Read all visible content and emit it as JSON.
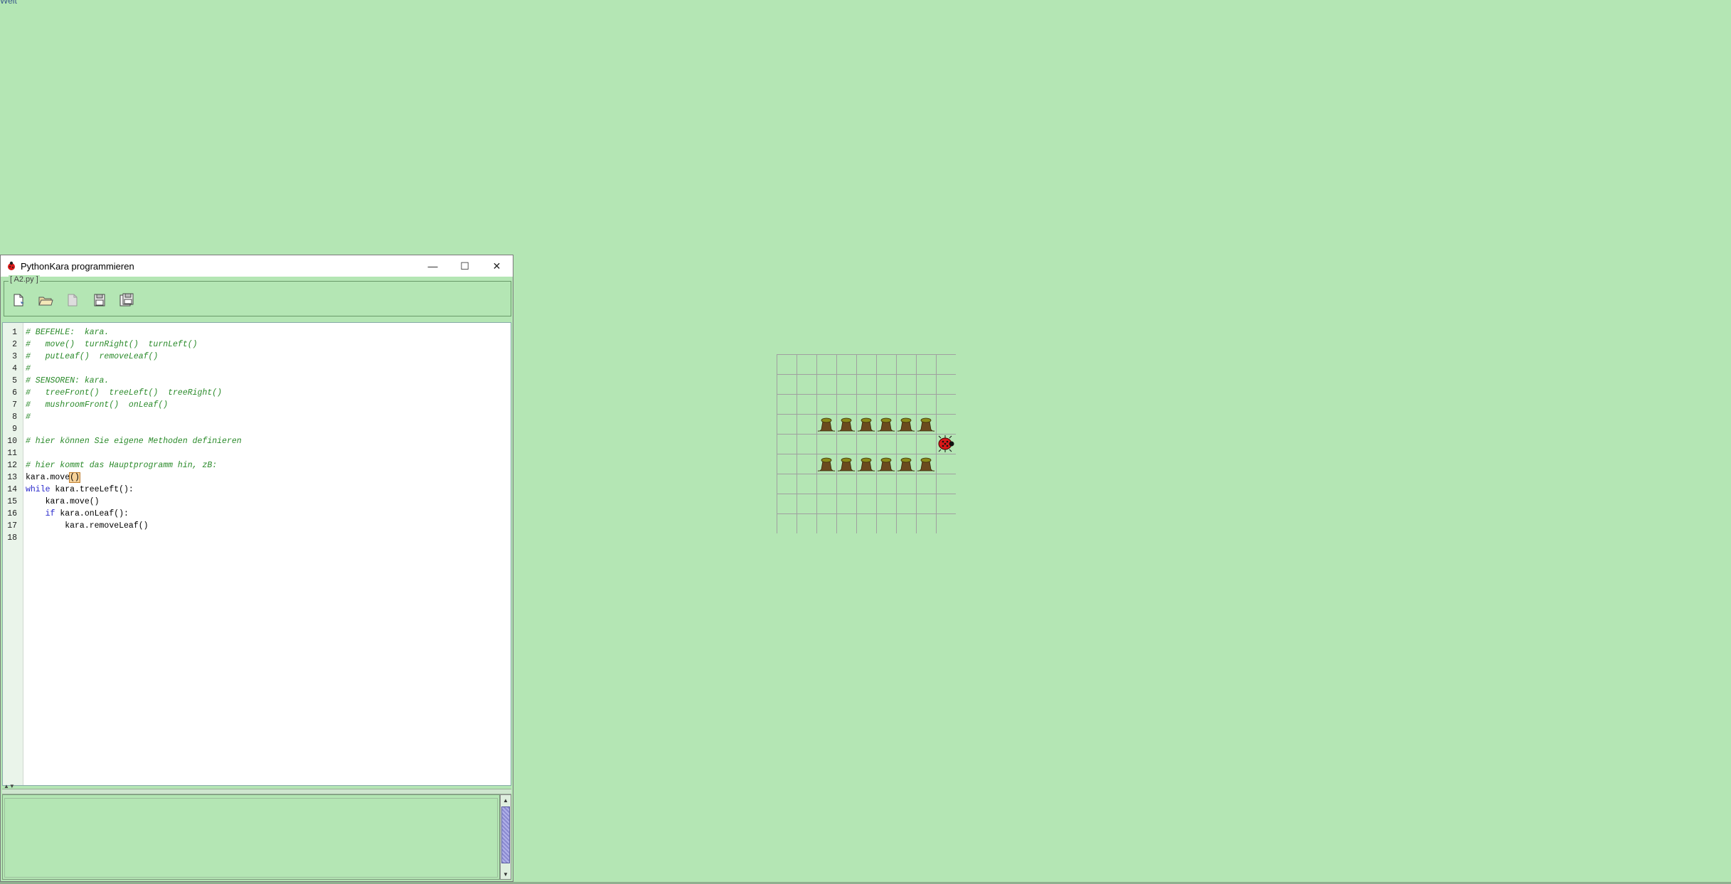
{
  "desktop": {
    "corner_text": "Welt"
  },
  "window": {
    "title": "PythonKara programmieren",
    "minimize": "—",
    "maximize": "☐",
    "close": "✕",
    "file_label": "[ A2.py ]",
    "toolbar": {
      "new": "new-file-icon",
      "open": "open-folder-icon",
      "blank": "document-icon",
      "save": "save-icon",
      "save_as": "save-as-icon"
    }
  },
  "code_lines": [
    {
      "n": "1",
      "text": "# BEFEHLE:  kara."
    },
    {
      "n": "2",
      "text": "#   move()  turnRight()  turnLeft()"
    },
    {
      "n": "3",
      "text": "#   putLeaf()  removeLeaf()"
    },
    {
      "n": "4",
      "text": "#"
    },
    {
      "n": "5",
      "text": "# SENSOREN: kara."
    },
    {
      "n": "6",
      "text": "#   treeFront()  treeLeft()  treeRight()"
    },
    {
      "n": "7",
      "text": "#   mushroomFront()  onLeaf()"
    },
    {
      "n": "8",
      "text": "#"
    },
    {
      "n": "9",
      "text": ""
    },
    {
      "n": "10",
      "text": "# hier können Sie eigene Methoden definieren"
    },
    {
      "n": "11",
      "text": ""
    },
    {
      "n": "12",
      "text": "# hier kommt das Hauptprogramm hin, zB:"
    },
    {
      "n": "13",
      "text": "kara.move()"
    },
    {
      "n": "14",
      "kw": "while",
      "text": " kara.treeLeft():"
    },
    {
      "n": "15",
      "text": "    kara.move()"
    },
    {
      "n": "16",
      "kw": "    if",
      "text": " kara.onLeaf():"
    },
    {
      "n": "17",
      "text": "        kara.removeLeaf()"
    },
    {
      "n": "18",
      "text": ""
    }
  ],
  "colors": {
    "background": "#b4e6b4",
    "comment": "#2a8a2a",
    "keyword": "#2a2acc",
    "grid_line": "#a0a0a0",
    "tree_trunk": "#6b4a1e",
    "tree_leaf": "#8a8a1a",
    "kara_red": "#d81818"
  },
  "world": {
    "cols": 9,
    "rows": 9,
    "trees": [
      [
        2,
        3
      ],
      [
        3,
        3
      ],
      [
        4,
        3
      ],
      [
        5,
        3
      ],
      [
        6,
        3
      ],
      [
        7,
        3
      ],
      [
        2,
        5
      ],
      [
        3,
        5
      ],
      [
        4,
        5
      ],
      [
        5,
        5
      ],
      [
        6,
        5
      ],
      [
        7,
        5
      ]
    ],
    "kara": [
      8,
      4
    ],
    "kara_direction": "right"
  }
}
